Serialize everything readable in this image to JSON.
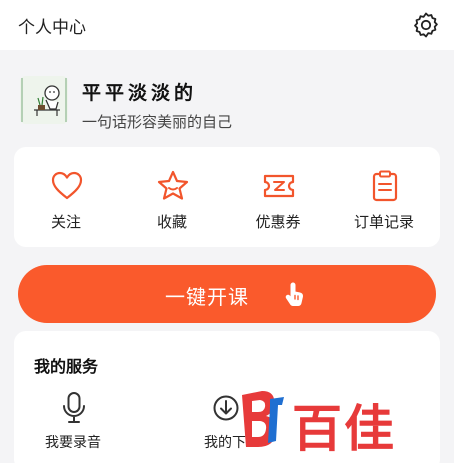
{
  "header": {
    "title": "个人中心",
    "settings_icon": "gear-icon"
  },
  "profile": {
    "nickname": "平平淡淡的",
    "signature": "一句话形容美丽的自己",
    "avatar_icon": "cartoon-avatar"
  },
  "quick_actions": [
    {
      "label": "关注",
      "icon": "heart-icon"
    },
    {
      "label": "收藏",
      "icon": "star-icon"
    },
    {
      "label": "优惠券",
      "icon": "ticket-icon"
    },
    {
      "label": "订单记录",
      "icon": "clipboard-icon"
    }
  ],
  "cta": {
    "label": "一键开课",
    "icon": "tap-hand-icon"
  },
  "services": {
    "title": "我的服务",
    "items": [
      {
        "label": "我要录音",
        "icon": "microphone-icon"
      },
      {
        "label": "我的下",
        "icon": "download-icon"
      }
    ]
  },
  "watermark": {
    "text": "百佳"
  },
  "colors": {
    "accent": "#fa5a2c",
    "background": "#f4f4f6",
    "card": "#ffffff"
  }
}
